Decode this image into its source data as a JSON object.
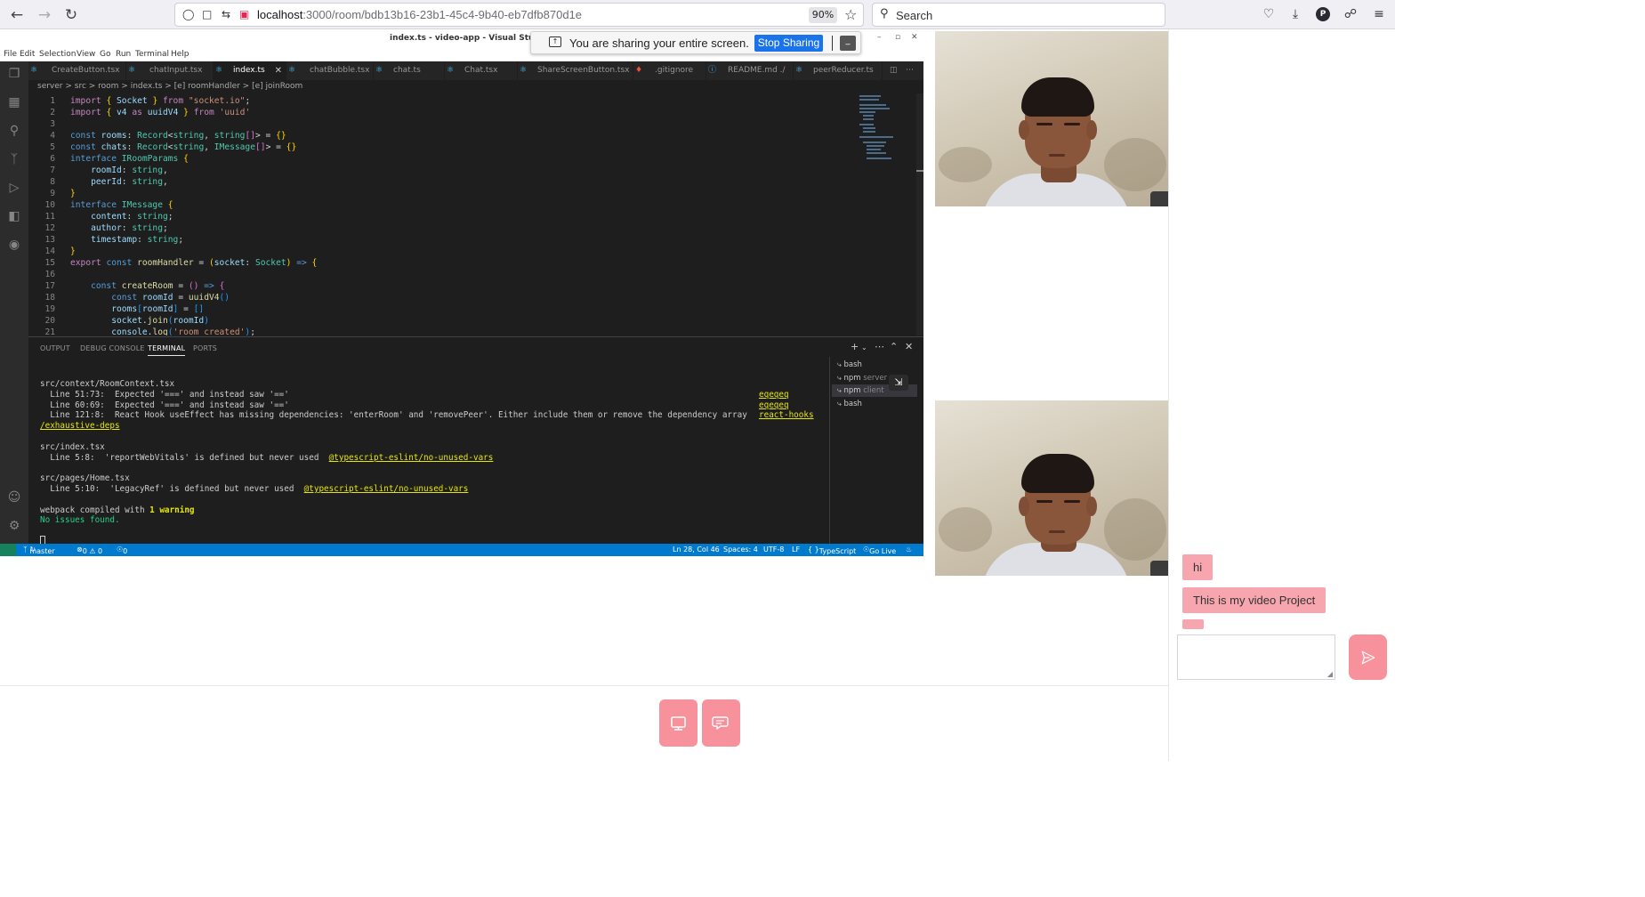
{
  "browser": {
    "url_host": "localhost",
    "url_path": ":3000/room/bdb13b16-23b1-45c4-9b40-eb7dfb870d1e",
    "zoom": "90%",
    "search_placeholder": "Search",
    "profile_initial": "P"
  },
  "share_banner": {
    "message": "You are sharing your entire screen.",
    "stop_label": "Stop Sharing",
    "hide_label": "_"
  },
  "vscode": {
    "title": "index.ts - video-app - Visual Studio Code",
    "menu": [
      "File",
      "Edit",
      "Selection",
      "View",
      "Go",
      "Run",
      "Terminal",
      "Help"
    ],
    "tabs": [
      "CreateButton.tsx",
      "chatInput.tsx",
      "index.ts",
      "chatBubble.tsx",
      "chat.ts",
      "Chat.tsx",
      "ShareScreenButton.tsx",
      ".gitignore",
      "README.md ./",
      "peerReducer.ts"
    ],
    "breadcrumb": "server  >  src  >  room  >  index.ts  >  [e] roomHandler  >  [e] joinRoom",
    "code_lines": [
      "1",
      "2",
      "3",
      "4",
      "5",
      "6",
      "7",
      "8",
      "9",
      "10",
      "11",
      "12",
      "13",
      "14",
      "15",
      "16",
      "17",
      "18",
      "19",
      "20",
      "21"
    ],
    "panel_tabs": [
      "OUTPUT",
      "DEBUG CONSOLE",
      "TERMINAL",
      "PORTS"
    ],
    "terminal_lines": {
      "l1": "src/context/RoomContext.tsx",
      "l2": "  Line 51:73:  Expected '===' and instead saw '=='",
      "l3": "  Line 60:69:  Expected '===' and instead saw '=='",
      "l4": "  Line 121:8:  React Hook useEffect has missing dependencies: 'enterRoom' and 'removePeer'. Either include them or remove the dependency array",
      "l5": "/exhaustive-deps",
      "l6": "src/index.tsx",
      "l7": "  Line 5:8:  'reportWebVitals' is defined but never used",
      "l7_rule": "@typescript-eslint/no-unused-vars",
      "l8": "src/pages/Home.tsx",
      "l9": "  Line 5:10:  'LegacyRef' is defined but never used",
      "l9_rule": "@typescript-eslint/no-unused-vars",
      "l10": "webpack compiled with ",
      "l10_bold": "1 warning",
      "l11": "No issues found.",
      "r1": "eqeqeq",
      "r2": "eqeqeq",
      "r3": "react-hooks"
    },
    "terminal_list": [
      {
        "name": "bash",
        "sub": ""
      },
      {
        "name": "npm",
        "sub": "server"
      },
      {
        "name": "npm",
        "sub": "client"
      },
      {
        "name": "bash",
        "sub": ""
      }
    ],
    "status": {
      "branch": "master",
      "problems": "0 ⚠ 0",
      "ports": "0",
      "position": "Ln 28, Col 46",
      "spaces": "Spaces: 4",
      "encoding": "UTF-8",
      "eol": "LF",
      "language": "TypeScript",
      "golive": "Go Live"
    }
  },
  "chat": {
    "messages": [
      "hi",
      "This is my video Project",
      ""
    ],
    "input_value": ""
  },
  "colors": {
    "accent_pink": "#f7929d",
    "bubble_pink": "#f7a5ae",
    "vscode_status": "#007acc",
    "stop_button": "#1a73e8"
  }
}
